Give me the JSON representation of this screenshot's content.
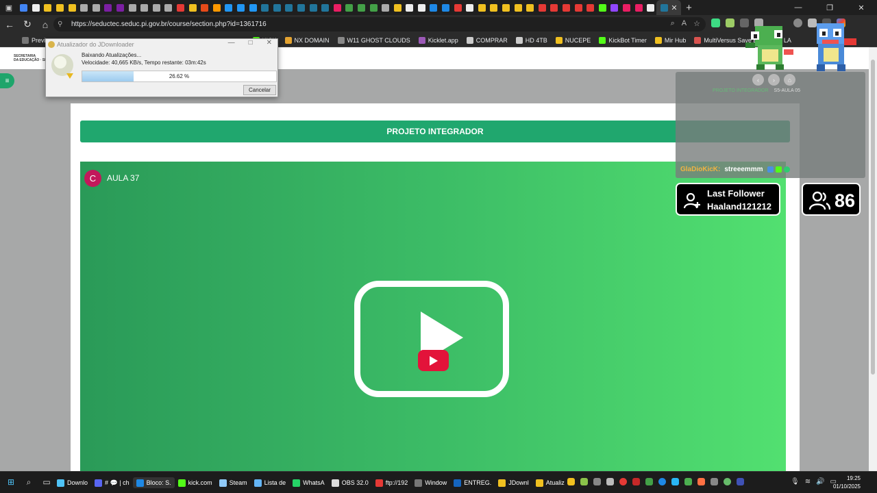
{
  "browser": {
    "url": "https://seductec.seduc.pi.gov.br/course/section.php?id=1361716",
    "bookmarks": [
      {
        "label": "Previ",
        "color": "#777777"
      },
      {
        "label": "KICK",
        "color": "#53fc18"
      },
      {
        "label": "NX DOMAIN",
        "color": "#e5a431"
      },
      {
        "label": "W11 GHOST CLOUDS",
        "color": "#888888"
      },
      {
        "label": "Kicklet.app",
        "color": "#9b59b6"
      },
      {
        "label": "COMPRAR",
        "color": "#cccccc"
      },
      {
        "label": "HD 4TB",
        "color": "#cccccc"
      },
      {
        "label": "NUCEPE",
        "color": "#f0c020"
      },
      {
        "label": "KickBot Timer",
        "color": "#53fc18"
      },
      {
        "label": "Mir Hub",
        "color": "#f0c020"
      },
      {
        "label": "MultiVersus Save Ed...",
        "color": "#d9534f"
      },
      {
        "label": "LA",
        "color": "#d9534f"
      }
    ]
  },
  "dialog": {
    "title": "Atualizador do JDownloader",
    "status": "Baixando Atualizações...",
    "speed": "Velocidade: 40,665 KB/s, Tempo restante: 03m:42s",
    "progress_label": "26.62 %",
    "progress": 26.62,
    "cancel_label": "Cancelar"
  },
  "page": {
    "section_title": "PROJETO INTEGRADOR",
    "video_channel_initial": "C",
    "video_title": "AULA 37"
  },
  "overlay": {
    "breadcrumb_1": "PROJETO INTEGRADOR",
    "breadcrumb_2": "S5-AULA 05",
    "chat_user": "GlaDioKicK:",
    "chat_message": "streeemmm",
    "follower_title": "Last Follower",
    "follower_name": "Haaland121212",
    "viewer_count": "86"
  },
  "taskbar": {
    "apps": [
      {
        "label": "Downlo",
        "color": "#4fc3f7"
      },
      {
        "label": "# 💬 | ch",
        "color": "#5865f2"
      },
      {
        "label": "Bloco: S.",
        "color": "#1e88e5"
      },
      {
        "label": "kick.com",
        "color": "#53fc18"
      },
      {
        "label": "Steam",
        "color": "#90caf9"
      },
      {
        "label": "Lista de",
        "color": "#64b5f6"
      },
      {
        "label": "WhatsA",
        "color": "#25d366"
      },
      {
        "label": "OBS 32.0",
        "color": "#dddddd"
      },
      {
        "label": "ftp://192",
        "color": "#e53935"
      },
      {
        "label": "Window",
        "color": "#777777"
      },
      {
        "label": "ENTREG.",
        "color": "#1565c0"
      },
      {
        "label": "JDownl",
        "color": "#f0c020"
      },
      {
        "label": "Atualiz",
        "color": "#f0c020"
      }
    ],
    "time": "19:25",
    "date": "01/10/2025"
  },
  "colors": {
    "accent_green": "#20a76e",
    "youtube_red": "#e3133a"
  }
}
